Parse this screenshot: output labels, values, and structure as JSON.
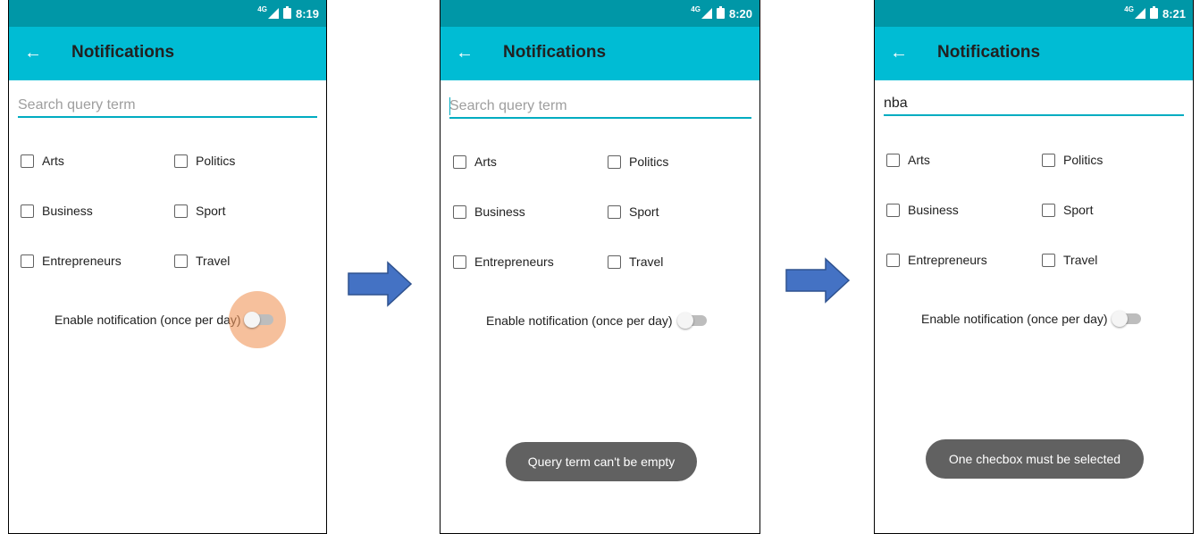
{
  "screens": [
    {
      "status_time": "8:19",
      "network": "4G",
      "title": "Notifications",
      "search_placeholder": "Search query term",
      "search_value": "",
      "categories": [
        "Arts",
        "Politics",
        "Business",
        "Sport",
        "Entrepreneurs",
        "Travel"
      ],
      "toggle_label": "Enable notification (once per day)",
      "toast": ""
    },
    {
      "status_time": "8:20",
      "network": "4G",
      "title": "Notifications",
      "search_placeholder": "Search query term",
      "search_value": "",
      "categories": [
        "Arts",
        "Politics",
        "Business",
        "Sport",
        "Entrepreneurs",
        "Travel"
      ],
      "toggle_label": "Enable notification (once per day)",
      "toast": "Query term can't be empty"
    },
    {
      "status_time": "8:21",
      "network": "4G",
      "title": "Notifications",
      "search_placeholder": "Search query term",
      "search_value": "nba",
      "categories": [
        "Arts",
        "Politics",
        "Business",
        "Sport",
        "Entrepreneurs",
        "Travel"
      ],
      "toggle_label": "Enable notification (once per day)",
      "toast": "One checbox must be selected"
    }
  ],
  "colors": {
    "status_bar": "#0097a7",
    "app_bar": "#00bcd4",
    "input_underline": "#00acc1",
    "toast_bg": "#616161",
    "arrow_fill": "#4472c4",
    "ripple": "#f0965a"
  },
  "icons": {
    "back": "arrow-left-icon",
    "flow": "arrow-right-icon"
  }
}
